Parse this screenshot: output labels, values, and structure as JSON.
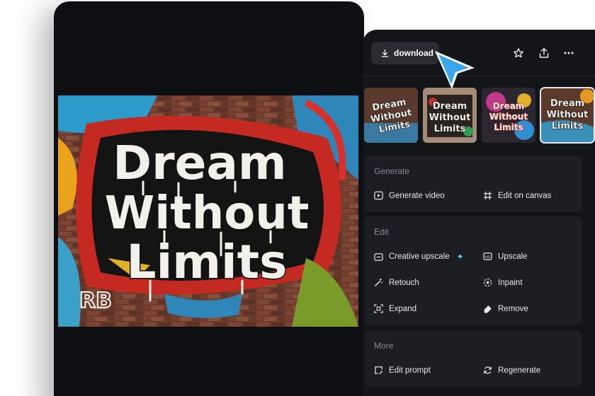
{
  "image": {
    "graffiti_lines": [
      "Dream",
      "Without",
      "Limits"
    ],
    "tag": "RB"
  },
  "toolbar": {
    "download_label": "download",
    "icons": [
      "download-icon",
      "star-icon",
      "share-icon",
      "more-icon"
    ]
  },
  "thumbnails": [
    {
      "line1": "Dream",
      "line2": "Without",
      "line3": "Limits",
      "selected": false
    },
    {
      "line1": "Dream",
      "line2": "Without",
      "line3": "Limits",
      "selected": false
    },
    {
      "line1": "Dream",
      "line2": "Without",
      "line3": "Limits",
      "selected": false
    },
    {
      "line1": "Dream",
      "line2": "Without",
      "line3": "Limits",
      "selected": true
    }
  ],
  "sections": {
    "generate": {
      "title": "Generate",
      "actions": [
        {
          "label": "Generate video",
          "icon": "play-icon"
        },
        {
          "label": "Edit on canvas",
          "icon": "canvas-icon"
        }
      ]
    },
    "edit": {
      "title": "Edit",
      "actions": [
        {
          "label": "Creative upscale",
          "icon": "creative-upscale-icon"
        },
        {
          "label": "Upscale",
          "icon": "upscale-icon"
        },
        {
          "label": "Retouch",
          "icon": "magic-wand-icon"
        },
        {
          "label": "Inpaint",
          "icon": "inpaint-icon"
        },
        {
          "label": "Expand",
          "icon": "expand-icon"
        },
        {
          "label": "Remove",
          "icon": "eraser-icon"
        }
      ]
    },
    "more": {
      "title": "More",
      "actions": [
        {
          "label": "Edit prompt",
          "icon": "edit-prompt-icon"
        },
        {
          "label": "Regenerate",
          "icon": "regenerate-icon"
        }
      ]
    }
  },
  "colors": {
    "panel_bg": "#141519",
    "card_bg": "#1d1e23",
    "cursor_accent": "#3aa6f0",
    "sparkle": "#4fd0f0"
  }
}
